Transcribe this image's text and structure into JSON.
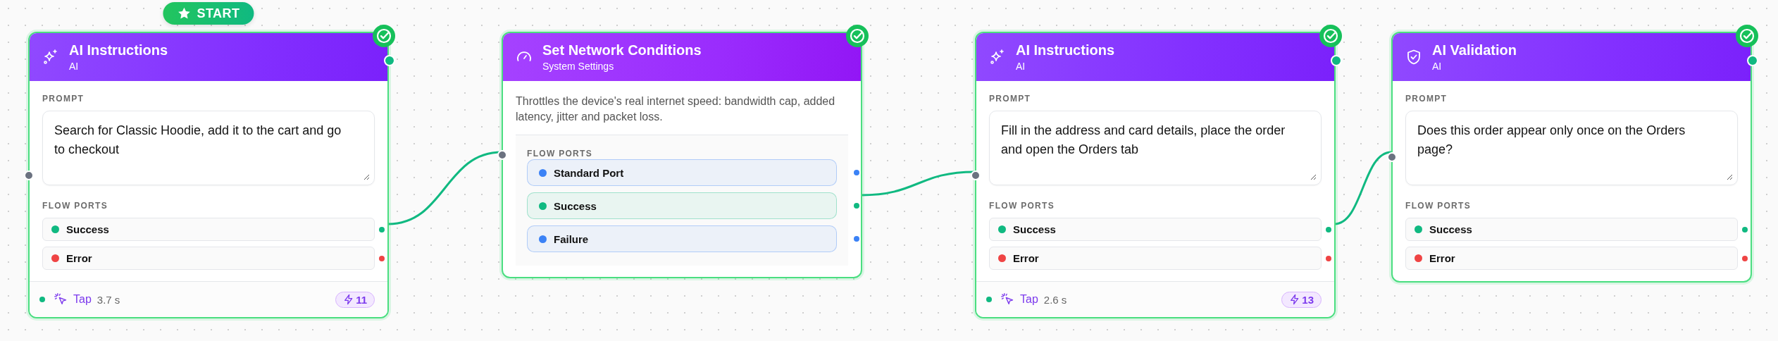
{
  "nodes": [
    {
      "kind": "instruction",
      "title": "AI Instructions",
      "subtitle": "AI",
      "badge": "START",
      "completed": true,
      "prompt_label": "PROMPT",
      "prompt": "Search for Classic Hoodie, add it to the cart and go to checkout",
      "ports_label": "FLOW PORTS",
      "ports": [
        {
          "label": "Success",
          "color": "#10b981"
        },
        {
          "label": "Error",
          "color": "#ef4444"
        }
      ],
      "footer": {
        "action": "Tap",
        "duration": "3.7 s",
        "count": "11"
      }
    },
    {
      "kind": "system",
      "title": "Set Network Conditions",
      "subtitle": "System Settings",
      "completed": true,
      "description": "Throttles the device's real internet speed: bandwidth cap, added latency, jitter and packet loss.",
      "ports_label": "FLOW PORTS",
      "ports": [
        {
          "label": "Standard Port",
          "color": "#3b82f6"
        },
        {
          "label": "Success",
          "color": "#10b981"
        },
        {
          "label": "Failure",
          "color": "#3b82f6"
        }
      ]
    },
    {
      "kind": "instruction",
      "title": "AI Instructions",
      "subtitle": "AI",
      "completed": true,
      "prompt_label": "PROMPT",
      "prompt": "Fill in the address and card details, place the order and open the Orders tab",
      "ports_label": "FLOW PORTS",
      "ports": [
        {
          "label": "Success",
          "color": "#10b981"
        },
        {
          "label": "Error",
          "color": "#ef4444"
        }
      ],
      "footer": {
        "action": "Tap",
        "duration": "2.6 s",
        "count": "13"
      }
    },
    {
      "kind": "validation",
      "title": "AI Validation",
      "subtitle": "AI",
      "completed": true,
      "prompt_label": "PROMPT",
      "prompt": "Does this order appear only once on the Orders page?",
      "ports_label": "FLOW PORTS",
      "ports": [
        {
          "label": "Success",
          "color": "#10b981"
        },
        {
          "label": "Error",
          "color": "#ef4444"
        }
      ]
    }
  ]
}
